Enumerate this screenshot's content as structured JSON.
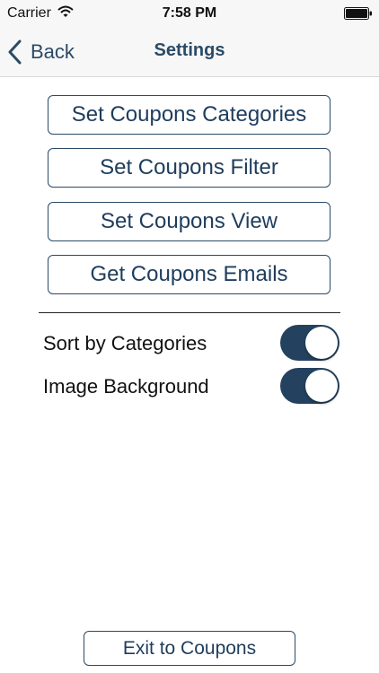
{
  "status_bar": {
    "carrier": "Carrier",
    "time": "7:58 PM",
    "wifi_icon": "wifi-icon",
    "battery_icon": "battery-icon"
  },
  "nav": {
    "back_label": "Back",
    "back_icon": "chevron-left-icon",
    "title": "Settings"
  },
  "buttons": {
    "categories": "Set Coupons Categories",
    "filter": "Set Coupons Filter",
    "view": "Set Coupons View",
    "emails": "Get Coupons Emails"
  },
  "toggles": [
    {
      "label": "Sort by Categories",
      "on": true
    },
    {
      "label": "Image Background",
      "on": true
    }
  ],
  "exit_label": "Exit to Coupons",
  "colors": {
    "accent": "#2b4a66",
    "toggle_on": "#24425f"
  }
}
